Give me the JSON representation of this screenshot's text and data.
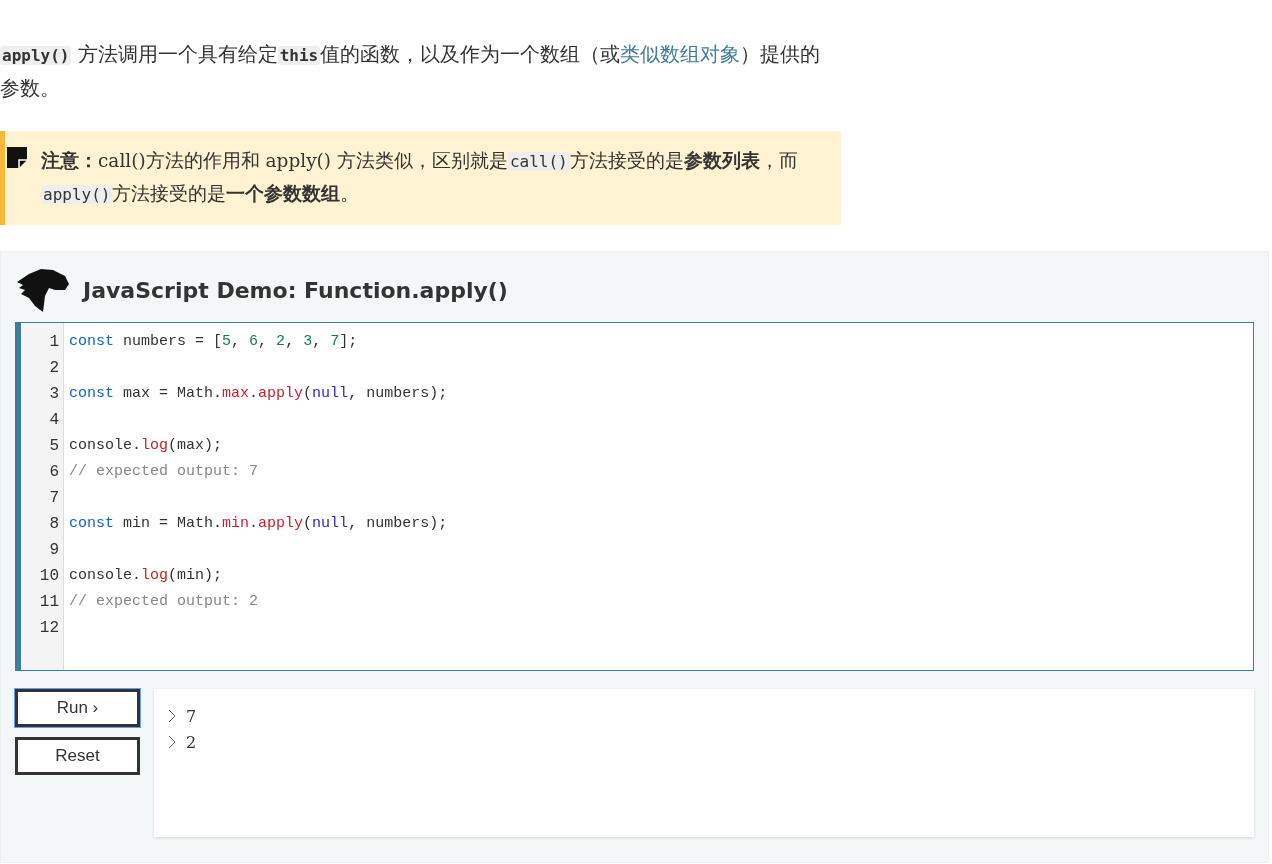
{
  "intro": [
    {
      "kind": "code",
      "text": "apply()"
    },
    {
      "kind": "text",
      "text": " 方法调用一个具有给定"
    },
    {
      "kind": "code",
      "text": "this"
    },
    {
      "kind": "text",
      "text": "值的函数，以及作为一个数组（或"
    },
    {
      "kind": "link",
      "text": "类似数组对象"
    },
    {
      "kind": "text",
      "text": "）提供的参数。"
    }
  ],
  "note": [
    {
      "kind": "bold",
      "text": "注意："
    },
    {
      "kind": "text",
      "text": "call()方法的作用和 apply() 方法类似，区别就是"
    },
    {
      "kind": "code",
      "text": "call()"
    },
    {
      "kind": "text",
      "text": "方法接受的是"
    },
    {
      "kind": "bold",
      "text": "参数列表"
    },
    {
      "kind": "text",
      "text": "，而"
    },
    {
      "kind": "code",
      "text": "apply()"
    },
    {
      "kind": "text",
      "text": "方法接受的是"
    },
    {
      "kind": "bold",
      "text": "一个参数数组"
    },
    {
      "kind": "text",
      "text": "。"
    }
  ],
  "demo": {
    "title": "JavaScript Demo: Function.apply()",
    "code_lines": [
      {
        "number": "1",
        "tokens": [
          {
            "kind": "keyword",
            "text": "const"
          },
          {
            "kind": "plain",
            "text": " numbers = ["
          },
          {
            "kind": "number",
            "text": "5"
          },
          {
            "kind": "plain",
            "text": ", "
          },
          {
            "kind": "number",
            "text": "6"
          },
          {
            "kind": "plain",
            "text": ", "
          },
          {
            "kind": "number",
            "text": "2"
          },
          {
            "kind": "plain",
            "text": ", "
          },
          {
            "kind": "number",
            "text": "3"
          },
          {
            "kind": "plain",
            "text": ", "
          },
          {
            "kind": "number",
            "text": "7"
          },
          {
            "kind": "plain",
            "text": "];"
          }
        ]
      },
      {
        "number": "2"
      },
      {
        "number": "3",
        "tokens": [
          {
            "kind": "keyword",
            "text": "const"
          },
          {
            "kind": "plain",
            "text": " max = Math."
          },
          {
            "kind": "property",
            "text": "max"
          },
          {
            "kind": "plain",
            "text": "."
          },
          {
            "kind": "property",
            "text": "apply"
          },
          {
            "kind": "plain",
            "text": "("
          },
          {
            "kind": "atom",
            "text": "null"
          },
          {
            "kind": "plain",
            "text": ", numbers);"
          }
        ]
      },
      {
        "number": "4"
      },
      {
        "number": "5",
        "tokens": [
          {
            "kind": "plain",
            "text": "console."
          },
          {
            "kind": "property",
            "text": "log"
          },
          {
            "kind": "plain",
            "text": "(max);"
          }
        ]
      },
      {
        "number": "6",
        "tokens": [
          {
            "kind": "comment",
            "text": "// expected output: 7"
          }
        ]
      },
      {
        "number": "7"
      },
      {
        "number": "8",
        "tokens": [
          {
            "kind": "keyword",
            "text": "const"
          },
          {
            "kind": "plain",
            "text": " min = Math."
          },
          {
            "kind": "property",
            "text": "min"
          },
          {
            "kind": "plain",
            "text": "."
          },
          {
            "kind": "property",
            "text": "apply"
          },
          {
            "kind": "plain",
            "text": "("
          },
          {
            "kind": "atom",
            "text": "null"
          },
          {
            "kind": "plain",
            "text": ", numbers);"
          }
        ]
      },
      {
        "number": "9"
      },
      {
        "number": "10",
        "tokens": [
          {
            "kind": "plain",
            "text": "console."
          },
          {
            "kind": "property",
            "text": "log"
          },
          {
            "kind": "plain",
            "text": "(min);"
          }
        ]
      },
      {
        "number": "11",
        "tokens": [
          {
            "kind": "comment",
            "text": "// expected output: 2"
          }
        ]
      },
      {
        "number": "12"
      }
    ],
    "buttons": [
      {
        "label": "Run ›",
        "focused": true
      },
      {
        "label": "Reset",
        "focused": false
      }
    ],
    "output": [
      "7",
      "2"
    ]
  }
}
